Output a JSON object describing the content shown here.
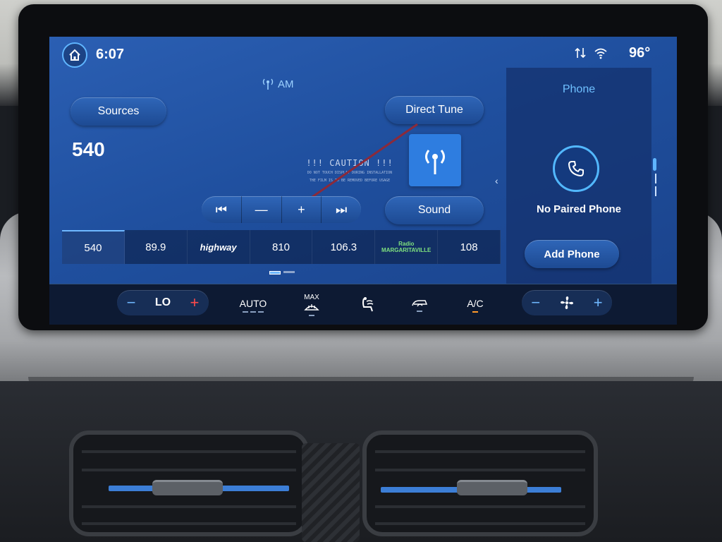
{
  "status_bar": {
    "time": "6:07",
    "temperature": "96°",
    "icons": [
      "home-icon",
      "data-transfer-icon",
      "wifi-icon"
    ]
  },
  "audio": {
    "band": "AM",
    "frequency": "540",
    "sources_label": "Sources",
    "direct_tune_label": "Direct Tune",
    "sound_label": "Sound",
    "caution_title": "!!! CAUTION !!!",
    "caution_line1": "DO NOT TOUCH DISPLAY DURING INSTALLATION",
    "caution_line2": "THE FILM IS TO BE REMOVED BEFORE USAGE",
    "tuner": {
      "seek_back": "⏮",
      "minus": "—",
      "plus": "+",
      "seek_forward": "⏭"
    },
    "presets": [
      "540",
      "89.9",
      "highway",
      "810",
      "106.3",
      "Radio MARGARITAVILLE",
      "108"
    ]
  },
  "phone": {
    "title": "Phone",
    "status": "No Paired Phone",
    "add_label": "Add Phone"
  },
  "climate": {
    "driver_temp": "LO",
    "auto_label": "AUTO",
    "max_label": "MAX",
    "ac_label": "A/C"
  },
  "colors": {
    "accent": "#5fb5ff",
    "screen_bg": "#1f4f9e",
    "heat_plus": "#ff4a4a",
    "indicator_on": "#ff9a2a"
  }
}
